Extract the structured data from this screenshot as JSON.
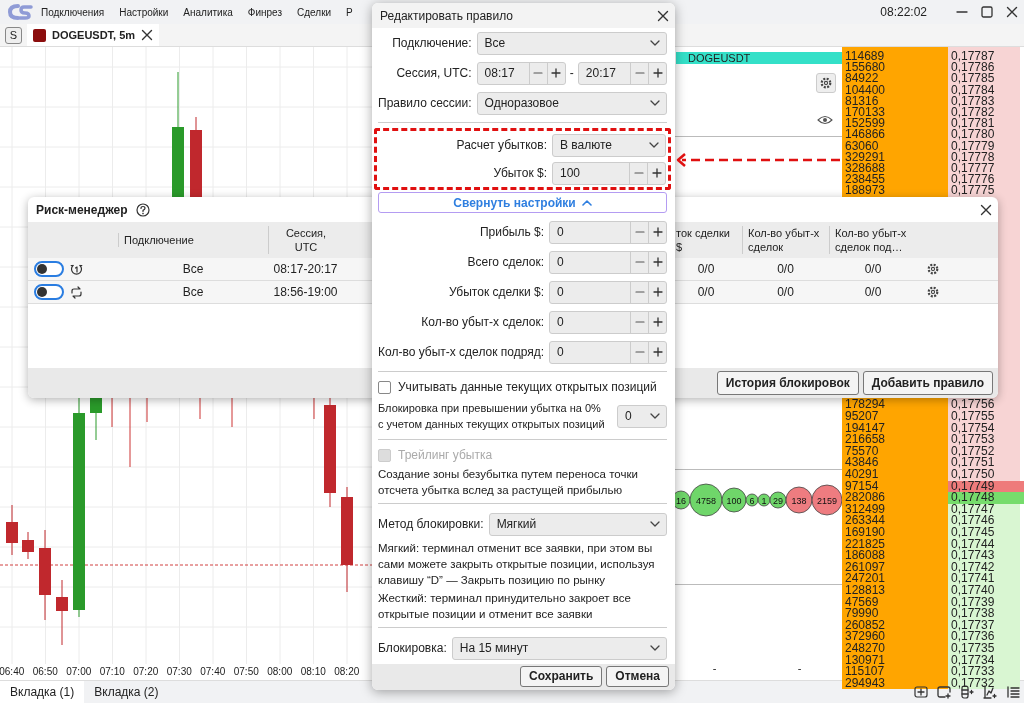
{
  "app_bar": {
    "menu": [
      "Подключения",
      "Настройки",
      "Аналитика",
      "Финрез",
      "Сделки",
      "Р"
    ],
    "clock": "08:22:02"
  },
  "chart_tab": {
    "badge": "S",
    "title": "DOGEUSDT, 5m"
  },
  "chart": {
    "time_labels": [
      "06:40",
      "06:50",
      "07:00",
      "07:10",
      "07:20",
      "07:30",
      "07:40",
      "07:50",
      "08:00",
      "08:10",
      "08:20"
    ]
  },
  "side_panel": {
    "instrument": "DOGEUSDT",
    "bubbles": [
      {
        "label": "16",
        "color": "#6fd66a"
      },
      {
        "label": "4758",
        "color": "#6fd66a"
      },
      {
        "label": "100",
        "color": "#6fd66a"
      },
      {
        "label": "6",
        "color": "#6fd66a"
      },
      {
        "label": "1",
        "color": "#6fd66a"
      },
      {
        "label": "29",
        "color": "#6fd66a"
      },
      {
        "label": "138",
        "color": "#ee7c80"
      },
      {
        "label": "2159",
        "color": "#ee7c80"
      }
    ],
    "footer_cells": [
      "-",
      "-"
    ]
  },
  "order_book": {
    "upper": [
      {
        "volume": "114689",
        "price": "0,17787",
        "ask": true,
        "best": false
      },
      {
        "volume": "155680",
        "price": "0,17786",
        "ask": true,
        "best": false
      },
      {
        "volume": "84922",
        "price": "0,17785",
        "ask": true,
        "best": false
      },
      {
        "volume": "104400",
        "price": "0,17784",
        "ask": true,
        "best": false
      },
      {
        "volume": "81316",
        "price": "0,17783",
        "ask": true,
        "best": false
      },
      {
        "volume": "170133",
        "price": "0,17782",
        "ask": true,
        "best": false
      },
      {
        "volume": "152599",
        "price": "0,17781",
        "ask": true,
        "best": false
      },
      {
        "volume": "146866",
        "price": "0,17780",
        "ask": true,
        "best": false
      },
      {
        "volume": "63060",
        "price": "0,17779",
        "ask": true,
        "best": false
      },
      {
        "volume": "329291",
        "price": "0,17778",
        "ask": true,
        "best": false
      },
      {
        "volume": "328688",
        "price": "0,17777",
        "ask": true,
        "best": false
      },
      {
        "volume": "238455",
        "price": "0,17776",
        "ask": true,
        "best": false
      },
      {
        "volume": "188973",
        "price": "0,17775",
        "ask": true,
        "best": false
      }
    ],
    "lower": [
      {
        "volume": "178294",
        "price": "0,17756",
        "ask": true,
        "best": false
      },
      {
        "volume": "95207",
        "price": "0,17755",
        "ask": true,
        "best": false
      },
      {
        "volume": "194147",
        "price": "0,17754",
        "ask": true,
        "best": false
      },
      {
        "volume": "216658",
        "price": "0,17753",
        "ask": true,
        "best": false
      },
      {
        "volume": "75570",
        "price": "0,17752",
        "ask": true,
        "best": false
      },
      {
        "volume": "43846",
        "price": "0,17751",
        "ask": true,
        "best": false
      },
      {
        "volume": "40291",
        "price": "0,17750",
        "ask": true,
        "best": false
      },
      {
        "volume": "97154",
        "price": "0,17749",
        "ask": true,
        "best": true
      },
      {
        "volume": "282086",
        "price": "0,17748",
        "ask": false,
        "best": true
      },
      {
        "volume": "312499",
        "price": "0,17747",
        "ask": false,
        "best": false
      },
      {
        "volume": "263344",
        "price": "0,17746",
        "ask": false,
        "best": false
      },
      {
        "volume": "169190",
        "price": "0,17745",
        "ask": false,
        "best": false
      },
      {
        "volume": "221825",
        "price": "0,17744",
        "ask": false,
        "best": false
      },
      {
        "volume": "186088",
        "price": "0,17743",
        "ask": false,
        "best": false
      },
      {
        "volume": "261097",
        "price": "0,17742",
        "ask": false,
        "best": false
      },
      {
        "volume": "247201",
        "price": "0,17741",
        "ask": false,
        "best": false
      },
      {
        "volume": "128813",
        "price": "0,17740",
        "ask": false,
        "best": false
      },
      {
        "volume": "47569",
        "price": "0,17739",
        "ask": false,
        "best": false
      },
      {
        "volume": "79990",
        "price": "0,17738",
        "ask": false,
        "best": false
      },
      {
        "volume": "260852",
        "price": "0,17737",
        "ask": false,
        "best": false
      },
      {
        "volume": "372960",
        "price": "0,17736",
        "ask": false,
        "best": false
      },
      {
        "volume": "248270",
        "price": "0,17735",
        "ask": false,
        "best": false
      },
      {
        "volume": "130971",
        "price": "0,17734",
        "ask": false,
        "best": false
      },
      {
        "volume": "115107",
        "price": "0,17733",
        "ask": false,
        "best": false
      },
      {
        "volume": "294943",
        "price": "0,17732",
        "ask": false,
        "best": false
      }
    ]
  },
  "bottom_tabs": [
    {
      "label": "Вкладка (1)",
      "selected": true
    },
    {
      "label": "Вкладка (2)",
      "selected": false
    }
  ],
  "risk_manager": {
    "title": "Риск-менеджер",
    "columns_left": [
      "Подключение",
      "Сессия, UTC"
    ],
    "columns_right": [
      "ток сделки $",
      "Кол-во убыт-х сделок",
      "Кол-во убыт-х сделок под…"
    ],
    "rows": [
      {
        "on": false,
        "kind": "once",
        "connection": "Все",
        "session": "08:17-20:17",
        "right_cells": [
          "0/0",
          "0/0",
          "0/0"
        ]
      },
      {
        "on": false,
        "kind": "repeat",
        "connection": "Все",
        "session": "18:56-19:00",
        "right_cells": [
          "0/0",
          "0/0",
          "0/0"
        ]
      }
    ],
    "buttons": [
      "История блокировок",
      "Добавить правило"
    ]
  },
  "dialog": {
    "title": "Редактировать правило",
    "blocks": [
      {
        "kind": "fields",
        "fields": [
          {
            "label": "Подключение:",
            "kind": "select",
            "value": "Все"
          },
          {
            "label": "Сессия, UTC:",
            "kind": "range",
            "from": "08:17",
            "separator": "-",
            "to": "20:17"
          },
          {
            "label": "Правило сессии:",
            "kind": "select",
            "value": "Одноразовое"
          }
        ]
      },
      {
        "kind": "divider"
      },
      {
        "kind": "annotated",
        "fields": [
          {
            "label": "Расчет убытков:",
            "kind": "select",
            "value": "В валюте"
          },
          {
            "label": "Убыток $:",
            "kind": "spin",
            "value": "100"
          }
        ]
      },
      {
        "kind": "collapse",
        "label": "Свернуть настройки",
        "expanded": true
      },
      {
        "kind": "fields",
        "fields": [
          {
            "label": "Прибыль $:",
            "kind": "spin",
            "value": "0"
          },
          {
            "label": "Всего сделок:",
            "kind": "spin",
            "value": "0"
          },
          {
            "label": "Убыток сделки $:",
            "kind": "spin",
            "value": "0"
          },
          {
            "label": "Кол-во убыт-х сделок:",
            "kind": "spin",
            "value": "0"
          },
          {
            "label": "Кол-во убыт-х сделок подряд:",
            "kind": "spin",
            "value": "0"
          }
        ]
      },
      {
        "kind": "divider"
      },
      {
        "kind": "checkbox",
        "label": "Учитывать данные текущих открытых позиций",
        "checked": false,
        "disabled": false
      },
      {
        "kind": "note_select",
        "text": "Блокировка при превышении убытка на 0% с учетом данных текущих открытых позиций",
        "value": "0"
      },
      {
        "kind": "divider"
      },
      {
        "kind": "checkbox",
        "label": "Трейлинг убытка",
        "checked": false,
        "disabled": true
      },
      {
        "kind": "note",
        "text": "Создание зоны безубытка путем переноса точки отсчета убытка вслед за растущей прибылью"
      },
      {
        "kind": "divider"
      },
      {
        "kind": "fields",
        "fields": [
          {
            "label": "Метод блокировки:",
            "kind": "select",
            "value": "Мягкий"
          }
        ]
      },
      {
        "kind": "note",
        "text": "Мягкий: терминал отменит все заявки, при этом вы сами можете закрыть открытые позиции, используя клавишу “D” — Закрыть позицию по рынку"
      },
      {
        "kind": "note",
        "text": "Жесткий: терминал принудительно закроет все открытые позиции и отменит все заявки"
      },
      {
        "kind": "divider"
      },
      {
        "kind": "fields",
        "fields": [
          {
            "label": "Блокировка:",
            "kind": "select",
            "value": "На 15 минут"
          }
        ]
      }
    ],
    "buttons": [
      "Сохранить",
      "Отмена"
    ]
  }
}
